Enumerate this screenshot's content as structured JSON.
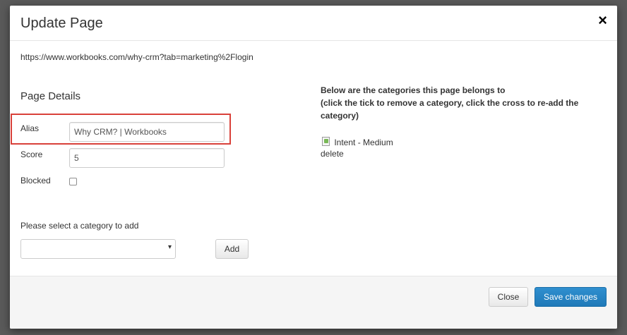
{
  "dialog": {
    "title": "Update Page",
    "close_glyph": "×",
    "url": "https://www.workbooks.com/why-crm?tab=marketing%2Flogin"
  },
  "details": {
    "section_title": "Page Details",
    "alias_label": "Alias",
    "alias_value": "Why CRM? | Workbooks",
    "score_label": "Score",
    "score_value": "5",
    "blocked_label": "Blocked",
    "blocked_checked": false,
    "highlight_color": "#d9413a"
  },
  "category_select": {
    "label": "Please select a category to add",
    "selected": "",
    "caret_glyph": "▾",
    "add_label": "Add"
  },
  "categories": {
    "intro_line1": "Below are the categories this page belongs to",
    "intro_line2": "(click the tick to remove a category, click the cross to re-add the category)",
    "items": [
      {
        "name": "Intent - Medium",
        "action_alt": "delete"
      }
    ]
  },
  "footer": {
    "close_label": "Close",
    "save_label": "Save changes",
    "primary_color": "#2a87c7"
  }
}
